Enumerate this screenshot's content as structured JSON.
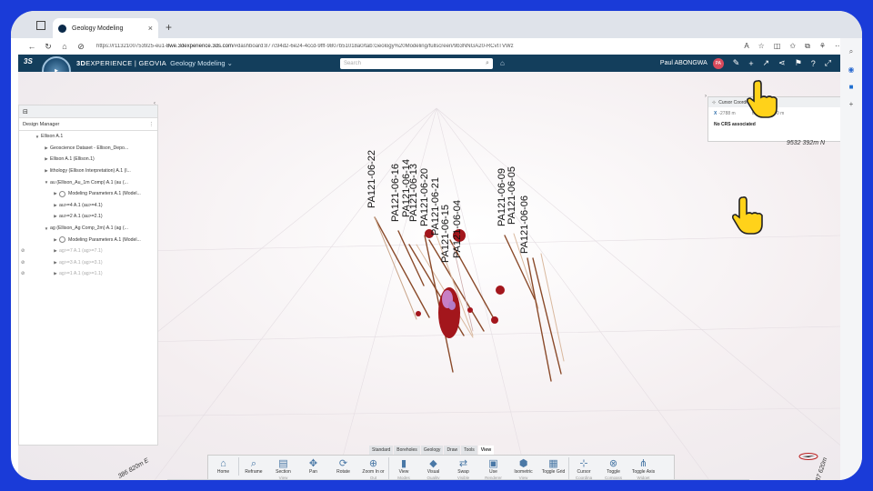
{
  "browser": {
    "tab_title": "Geology Modeling",
    "url_prefix": "https://r1132100753925-eu1-",
    "url_host": "8we.3dexperience.3ds.com",
    "url_rest": "/#dashboard:877c94d2-6e24-4ccd-9fff-9807b51018a0/tab:Geology%20Modeling/fullscreen/9b3NNGA20-RCvtTVWz"
  },
  "header": {
    "brand_prefix": "3D",
    "brand_rest": "EXPERIENCE | GEOVIA",
    "app_name": "Geology Modeling ⌄",
    "search_placeholder": "Search",
    "user_name": "Paul ABONGWA",
    "avatar_initials": "PA"
  },
  "design_manager": {
    "title": "Design Manager",
    "rows": [
      {
        "indent": 1,
        "twisty": "▼",
        "label": "Ellison A.1",
        "gear": false,
        "hidden": false
      },
      {
        "indent": 2,
        "twisty": "▶",
        "label": "Geoscience Dataset - Ellison_Depo...",
        "gear": false,
        "hidden": false
      },
      {
        "indent": 2,
        "twisty": "▶",
        "label": "Ellison A.1 (Ellison.1)",
        "gear": false,
        "hidden": false
      },
      {
        "indent": 2,
        "twisty": "▶",
        "label": "lithology (Ellison Interpretation) A.1 (l...",
        "gear": false,
        "hidden": false
      },
      {
        "indent": 2,
        "twisty": "▼",
        "label": "au (Ellison_Au_1m Comp) A.1 (au (...",
        "gear": false,
        "hidden": false
      },
      {
        "indent": 3,
        "twisty": "▶",
        "label": "Modeling Parameters A.1 (Model...",
        "gear": true,
        "hidden": false
      },
      {
        "indent": 3,
        "twisty": "▶",
        "label": "au>=4 A.1 (au>=4.1)",
        "gear": false,
        "hidden": false
      },
      {
        "indent": 3,
        "twisty": "▶",
        "label": "au>=2 A.1 (au>=2.1)",
        "gear": false,
        "hidden": false
      },
      {
        "indent": 2,
        "twisty": "▼",
        "label": "ag (Ellison_Ag Comp_2m) A.1 (ag (...",
        "gear": false,
        "hidden": false
      },
      {
        "indent": 3,
        "twisty": "▶",
        "label": "Modeling Parameters A.1 (Model...",
        "gear": true,
        "hidden": false
      },
      {
        "indent": 3,
        "twisty": "▶",
        "label": "ag>=7 A.1 (ag>=7.1)",
        "gear": false,
        "hidden": true
      },
      {
        "indent": 3,
        "twisty": "▶",
        "label": "ag>=3 A.1 (ag>=3.1)",
        "gear": false,
        "hidden": true
      },
      {
        "indent": 3,
        "twisty": "▶",
        "label": "ag>=1 A.1 (ag>=1.1)",
        "gear": false,
        "hidden": true
      }
    ]
  },
  "cursor_coordinates": {
    "title": "Cursor Coordi",
    "x_label": "X",
    "x_value": "-2788 m",
    "y_label": "m",
    "z_label": "Z",
    "z_value": "0 m",
    "crs_note": "No CRS associated"
  },
  "viewer": {
    "northing_label": "9532 392m N",
    "easting_left": "386 820m E",
    "easting_right": "387 620m E",
    "drillholes": [
      "PA121-06-22",
      "PA121-06-16",
      "PA121-06-14",
      "PA121-06-13",
      "PA121-06-20",
      "PA121-06-21",
      "PA121-06-15",
      "PA121-06-04",
      "PA121-06-09",
      "PA121-06-05",
      "PA121-06-06"
    ],
    "colors": {
      "hole_trace": "#8a4a2a",
      "ore_body": "#a3161c",
      "pink_body": "#c77fc4"
    }
  },
  "toolbar": {
    "tabs": [
      "Standard",
      "Boreholes",
      "Geology",
      "Draw",
      "Tools",
      "View"
    ],
    "active_tab": "View",
    "tools": [
      {
        "label": "Home",
        "sub": "",
        "icon": "home-icon"
      },
      {
        "label": "Reframe",
        "sub": "",
        "icon": "reframe-icon"
      },
      {
        "label": "Section",
        "sub": "View",
        "icon": "section-view-icon"
      },
      {
        "label": "Pan",
        "sub": "",
        "icon": "pan-icon"
      },
      {
        "label": "Rotate",
        "sub": "",
        "icon": "rotate-icon"
      },
      {
        "label": "Zoom In or",
        "sub": "Out",
        "icon": "zoom-icon"
      },
      {
        "label": "View",
        "sub": "Modes",
        "icon": "view-modes-icon"
      },
      {
        "label": "Visual",
        "sub": "Quality",
        "icon": "visual-quality-icon"
      },
      {
        "label": "Swap",
        "sub": "Visible",
        "icon": "swap-visible-icon"
      },
      {
        "label": "Use",
        "sub": "Renderer",
        "icon": "use-renderer-icon"
      },
      {
        "label": "Isometric",
        "sub": "View",
        "icon": "isometric-view-icon"
      },
      {
        "label": "Toggle Grid",
        "sub": "",
        "icon": "grid-icon"
      },
      {
        "label": "Cursor",
        "sub": "Coordina",
        "icon": "cursor-coordinates-icon"
      },
      {
        "label": "Toggle",
        "sub": "Compass",
        "icon": "compass-icon"
      },
      {
        "label": "Toggle Axis",
        "sub": "Widget",
        "icon": "axis-widget-icon"
      }
    ]
  }
}
